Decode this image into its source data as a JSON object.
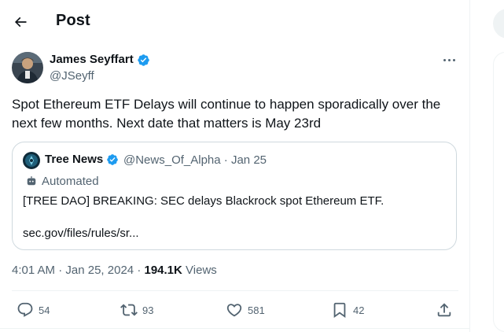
{
  "header": {
    "title": "Post"
  },
  "tweet": {
    "author_name": "James Seyffart",
    "author_handle": "@JSeyff",
    "text": "Spot Ethereum ETF Delays will continue to happen sporadically over the next few months. Next date that matters is May 23rd",
    "time": "4:01 AM",
    "separator": "·",
    "date": "Jan 25, 2024",
    "views_count": "194.1K",
    "views_label": "Views"
  },
  "quote": {
    "author_name": "Tree News",
    "author_handle": "@News_Of_Alpha",
    "separator": "·",
    "date": "Jan 25",
    "label": "Automated",
    "text": "[TREE DAO] BREAKING: SEC delays Blackrock spot Ethereum ETF.",
    "link": "sec.gov/files/rules/sr..."
  },
  "actions": {
    "replies": "54",
    "reposts": "93",
    "likes": "581",
    "bookmarks": "42"
  },
  "colors": {
    "accent": "#1d9bf0",
    "text": "#0f1419",
    "secondary": "#536471",
    "border": "#cfd9de"
  },
  "icons": [
    "back-arrow-icon",
    "verified-badge-icon",
    "more-icon",
    "bot-icon",
    "reply-icon",
    "repost-icon",
    "like-icon",
    "bookmark-icon",
    "share-icon"
  ]
}
